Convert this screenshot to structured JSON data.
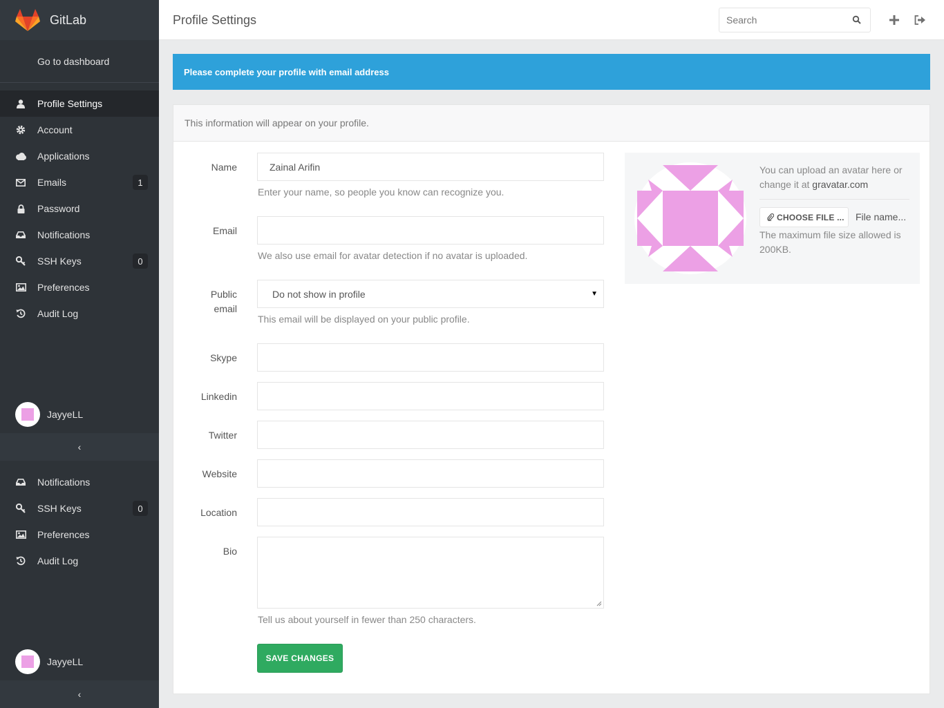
{
  "brand": {
    "name": "GitLab"
  },
  "sidebar": {
    "go_dashboard": "Go to dashboard",
    "items": [
      {
        "label": "Profile Settings",
        "icon": "user-icon",
        "active": true
      },
      {
        "label": "Account",
        "icon": "gear-icon"
      },
      {
        "label": "Applications",
        "icon": "cloud-icon"
      },
      {
        "label": "Emails",
        "icon": "envelope-icon",
        "badge": "1"
      },
      {
        "label": "Password",
        "icon": "lock-icon"
      },
      {
        "label": "Notifications",
        "icon": "inbox-icon"
      },
      {
        "label": "SSH Keys",
        "icon": "key-icon",
        "badge": "0"
      },
      {
        "label": "Preferences",
        "icon": "image-icon"
      },
      {
        "label": "Audit Log",
        "icon": "history-icon"
      }
    ],
    "user": {
      "name": "JayyeLL"
    },
    "collapse_glyph": "‹",
    "items_lower": [
      {
        "label": "Notifications",
        "icon": "inbox-icon"
      },
      {
        "label": "SSH Keys",
        "icon": "key-icon",
        "badge": "0"
      },
      {
        "label": "Preferences",
        "icon": "image-icon"
      },
      {
        "label": "Audit Log",
        "icon": "history-icon"
      }
    ],
    "user_lower": {
      "name": "JayyeLL"
    }
  },
  "header": {
    "title": "Profile Settings",
    "search_placeholder": "Search"
  },
  "alert": {
    "text": "Please complete your profile with email address"
  },
  "panel": {
    "heading": "This information will appear on your profile."
  },
  "form": {
    "name": {
      "label": "Name",
      "value": "Zainal Arifin",
      "help": "Enter your name, so people you know can recognize you."
    },
    "email": {
      "label": "Email",
      "value": "",
      "help": "We also use email for avatar detection if no avatar is uploaded."
    },
    "public_email": {
      "label_line1": "Public",
      "label_line2": "email",
      "selected": "Do not show in profile",
      "help": "This email will be displayed on your public profile."
    },
    "skype": {
      "label": "Skype",
      "value": ""
    },
    "linkedin": {
      "label": "Linkedin",
      "value": ""
    },
    "twitter": {
      "label": "Twitter",
      "value": ""
    },
    "website": {
      "label": "Website",
      "value": ""
    },
    "location": {
      "label": "Location",
      "value": ""
    },
    "bio": {
      "label": "Bio",
      "value": "",
      "help": "Tell us about yourself in fewer than 250 characters."
    },
    "save_label": "SAVE CHANGES"
  },
  "avatar": {
    "text_part1": "You can upload an avatar here or change it at ",
    "link": "gravatar.com",
    "choose_label": "CHOOSE FILE ...",
    "file_name": "File name...",
    "size_help": "The maximum file size allowed is 200KB."
  },
  "colors": {
    "sidebar_bg": "#2e3338",
    "alert_bg": "#2ea1da",
    "save_bg": "#2faa60",
    "identicon": "#eca0e5"
  }
}
